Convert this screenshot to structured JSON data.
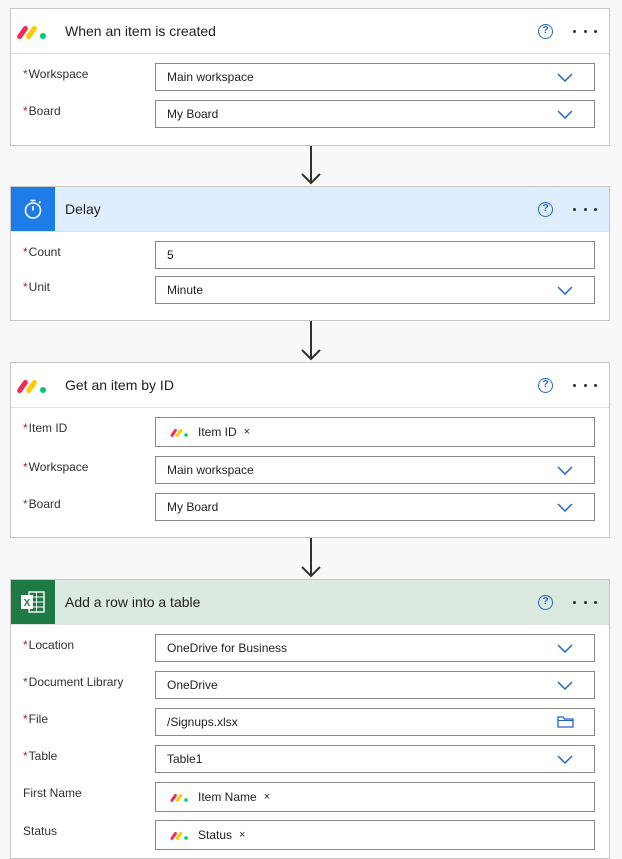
{
  "cards": {
    "trigger": {
      "title": "When an item is created",
      "fields": {
        "workspace": {
          "label": "Workspace",
          "value": "Main workspace"
        },
        "board": {
          "label": "Board",
          "value": "My Board"
        }
      }
    },
    "delay": {
      "title": "Delay",
      "fields": {
        "count": {
          "label": "Count",
          "value": "5"
        },
        "unit": {
          "label": "Unit",
          "value": "Minute"
        }
      }
    },
    "get_item": {
      "title": "Get an item by ID",
      "fields": {
        "item_id": {
          "label": "Item ID",
          "token": "Item ID"
        },
        "workspace": {
          "label": "Workspace",
          "value": "Main workspace"
        },
        "board": {
          "label": "Board",
          "value": "My Board"
        }
      }
    },
    "add_row": {
      "title": "Add a row into a table",
      "fields": {
        "location": {
          "label": "Location",
          "value": "OneDrive for Business"
        },
        "library": {
          "label": "Document Library",
          "value": "OneDrive"
        },
        "file": {
          "label": "File",
          "value": "/Signups.xlsx"
        },
        "table": {
          "label": "Table",
          "value": "Table1"
        },
        "first_name": {
          "label": "First Name",
          "token": "Item Name"
        },
        "status": {
          "label": "Status",
          "token": "Status"
        }
      }
    }
  },
  "common": {
    "required_mark": "*",
    "help_glyph": "?",
    "remove_glyph": "×"
  },
  "colors": {
    "delay_header_bg": "#dfeeff",
    "delay_icon_bg": "#1e7ce8",
    "excel_header_bg": "#dbeae0",
    "excel_icon_bg": "#1e7a45",
    "accent": "#2266c8",
    "required": "#a4262c"
  },
  "icons": [
    "monday-logo-icon",
    "timer-icon",
    "excel-icon",
    "help-icon",
    "more-icon",
    "chevron-down-icon",
    "folder-icon",
    "arrow-down-icon"
  ]
}
